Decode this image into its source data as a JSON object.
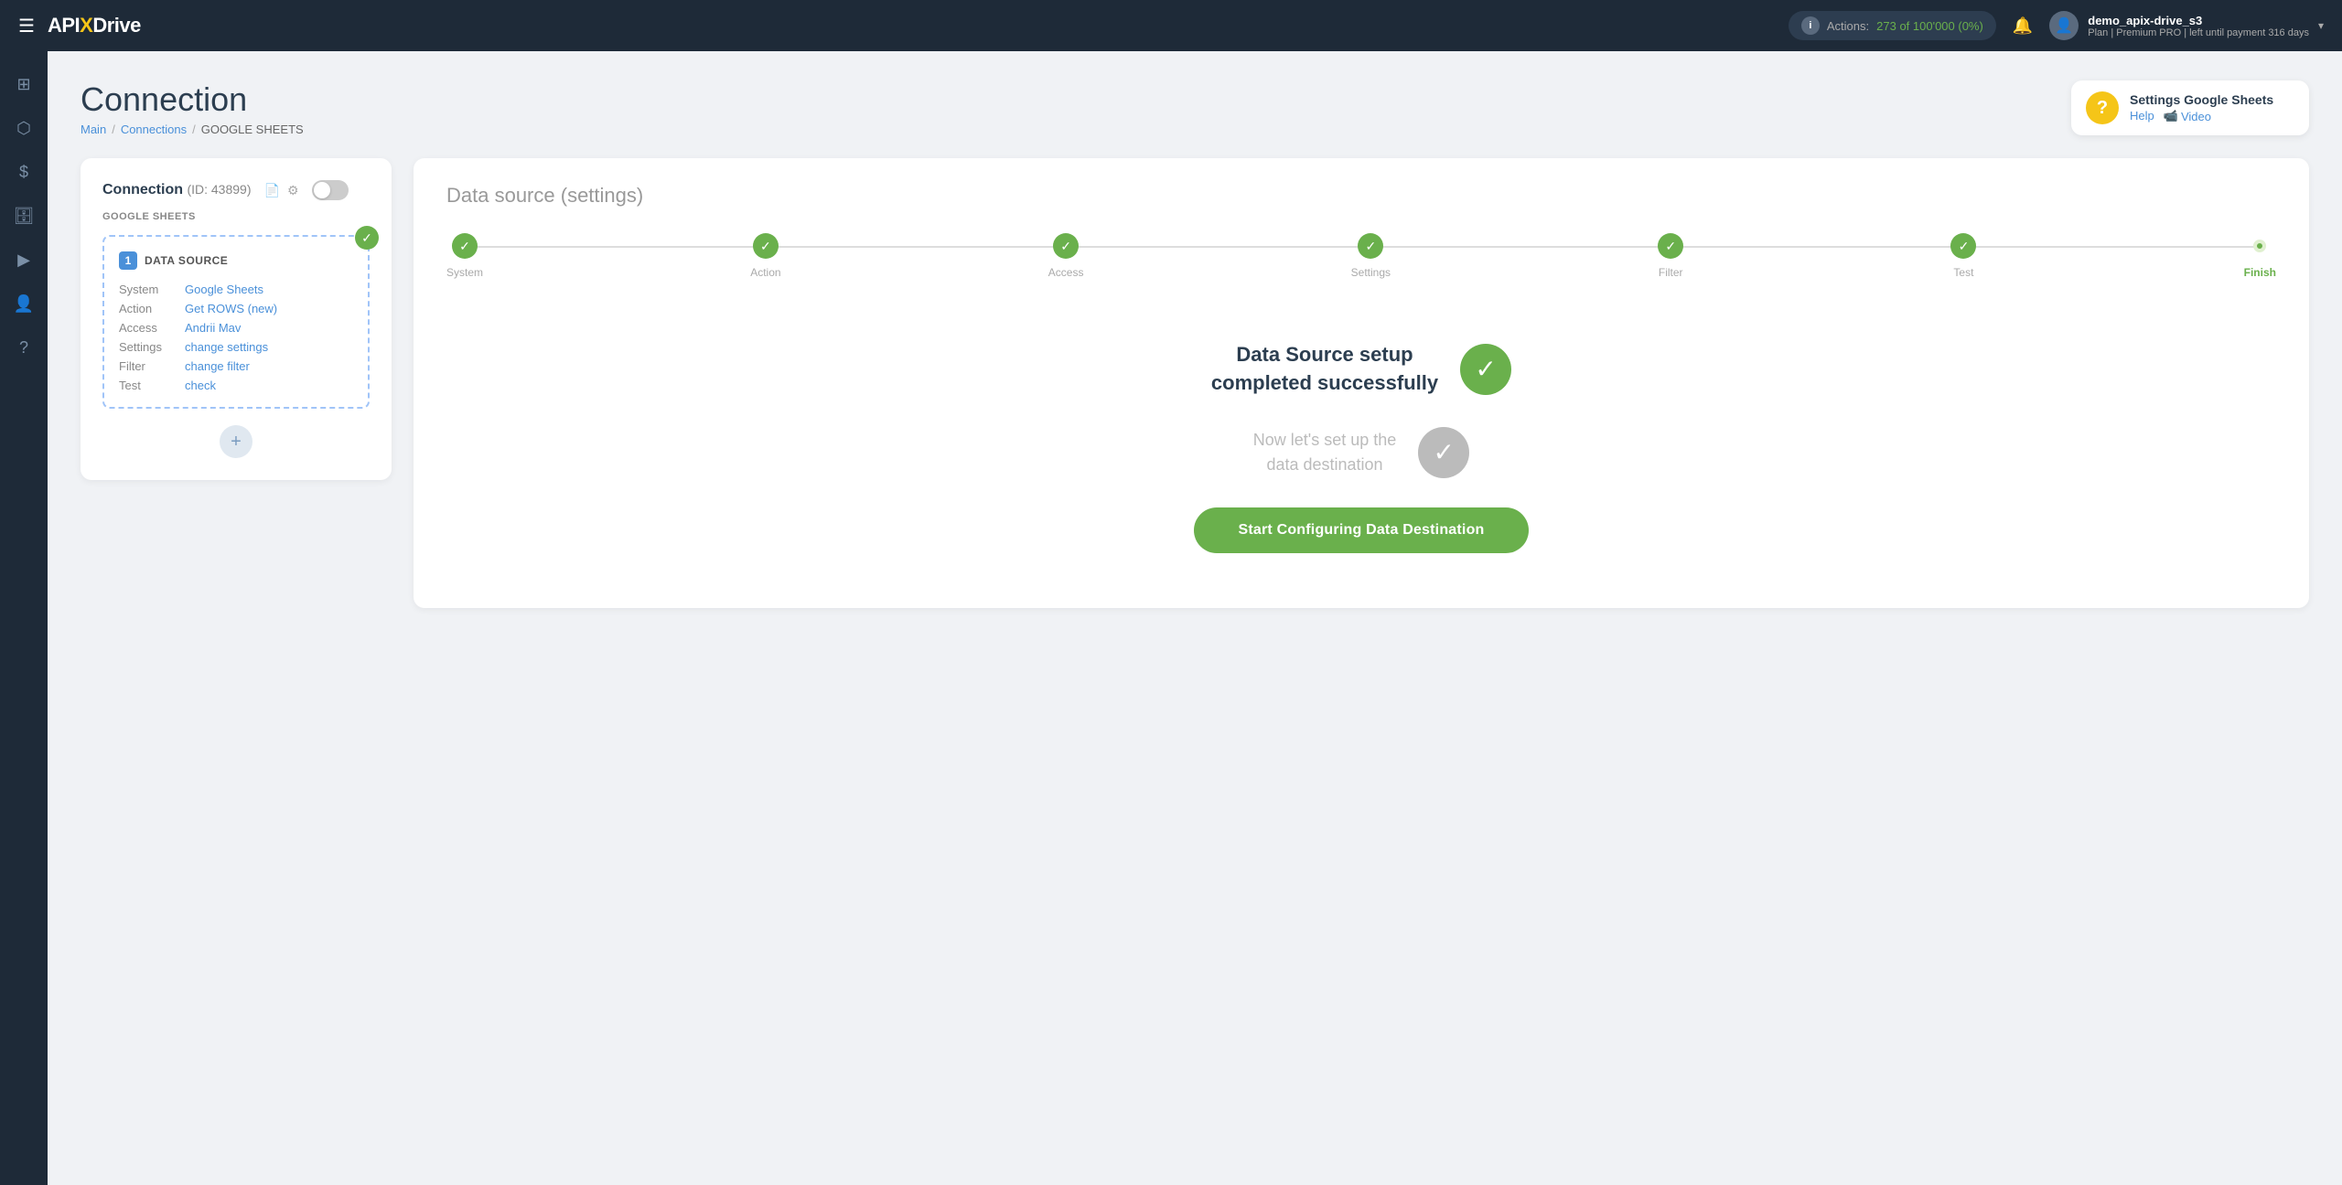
{
  "topnav": {
    "logo": "APIXDrive",
    "logo_highlight": "X",
    "actions_label": "Actions:",
    "actions_count": "273 of 100'000 (0%)",
    "user_name": "demo_apix-drive_s3",
    "user_plan": "Plan | Premium PRO | left until payment 316 days",
    "dropdown_label": "▾"
  },
  "sidebar": {
    "items": [
      {
        "icon": "⊞",
        "name": "dashboard"
      },
      {
        "icon": "⬡",
        "name": "flow"
      },
      {
        "icon": "$",
        "name": "billing"
      },
      {
        "icon": "🗄",
        "name": "data"
      },
      {
        "icon": "▶",
        "name": "video"
      },
      {
        "icon": "👤",
        "name": "profile"
      },
      {
        "icon": "?",
        "name": "help"
      }
    ]
  },
  "page": {
    "title": "Connection",
    "breadcrumb": {
      "main": "Main",
      "connections": "Connections",
      "current": "GOOGLE SHEETS"
    }
  },
  "help_widget": {
    "title": "Settings Google Sheets",
    "help_label": "Help",
    "video_label": "Video"
  },
  "left_card": {
    "connection_label": "Connection",
    "connection_id": "(ID: 43899)",
    "section_label": "GOOGLE SHEETS",
    "datasource": {
      "number": "1",
      "title": "DATA SOURCE",
      "rows": [
        {
          "key": "System",
          "value": "Google Sheets"
        },
        {
          "key": "Action",
          "value": "Get ROWS (new)"
        },
        {
          "key": "Access",
          "value": "Andrii Mav"
        },
        {
          "key": "Settings",
          "value": "change settings"
        },
        {
          "key": "Filter",
          "value": "change filter"
        },
        {
          "key": "Test",
          "value": "check"
        }
      ]
    },
    "add_btn": "+"
  },
  "right_card": {
    "title": "Data source",
    "title_sub": "(settings)",
    "stepper": {
      "steps": [
        {
          "label": "System",
          "state": "done"
        },
        {
          "label": "Action",
          "state": "done"
        },
        {
          "label": "Access",
          "state": "done"
        },
        {
          "label": "Settings",
          "state": "done"
        },
        {
          "label": "Filter",
          "state": "done"
        },
        {
          "label": "Test",
          "state": "done"
        },
        {
          "label": "Finish",
          "state": "current"
        }
      ]
    },
    "success_main": "Data Source setup\ncompleted successfully",
    "success_sub": "Now let's set up the\ndata destination",
    "start_btn": "Start Configuring Data Destination"
  }
}
